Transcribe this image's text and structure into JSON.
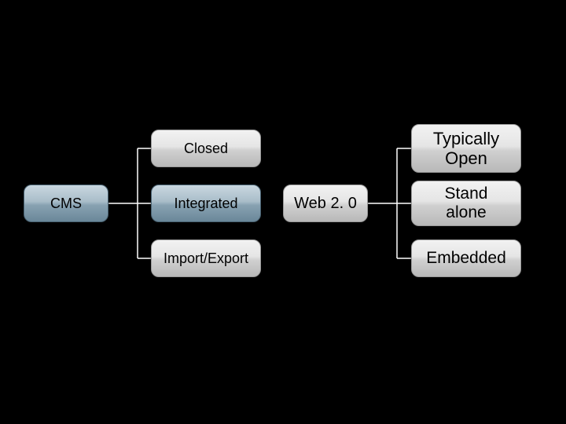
{
  "nodes": {
    "cms": "CMS",
    "closed": "Closed",
    "integrated": "Integrated",
    "importexport": "Import/Export",
    "web20": "Web 2. 0",
    "typically_open": "Typically\nOpen",
    "stand_alone": "Stand\nalone",
    "embedded": "Embedded"
  }
}
